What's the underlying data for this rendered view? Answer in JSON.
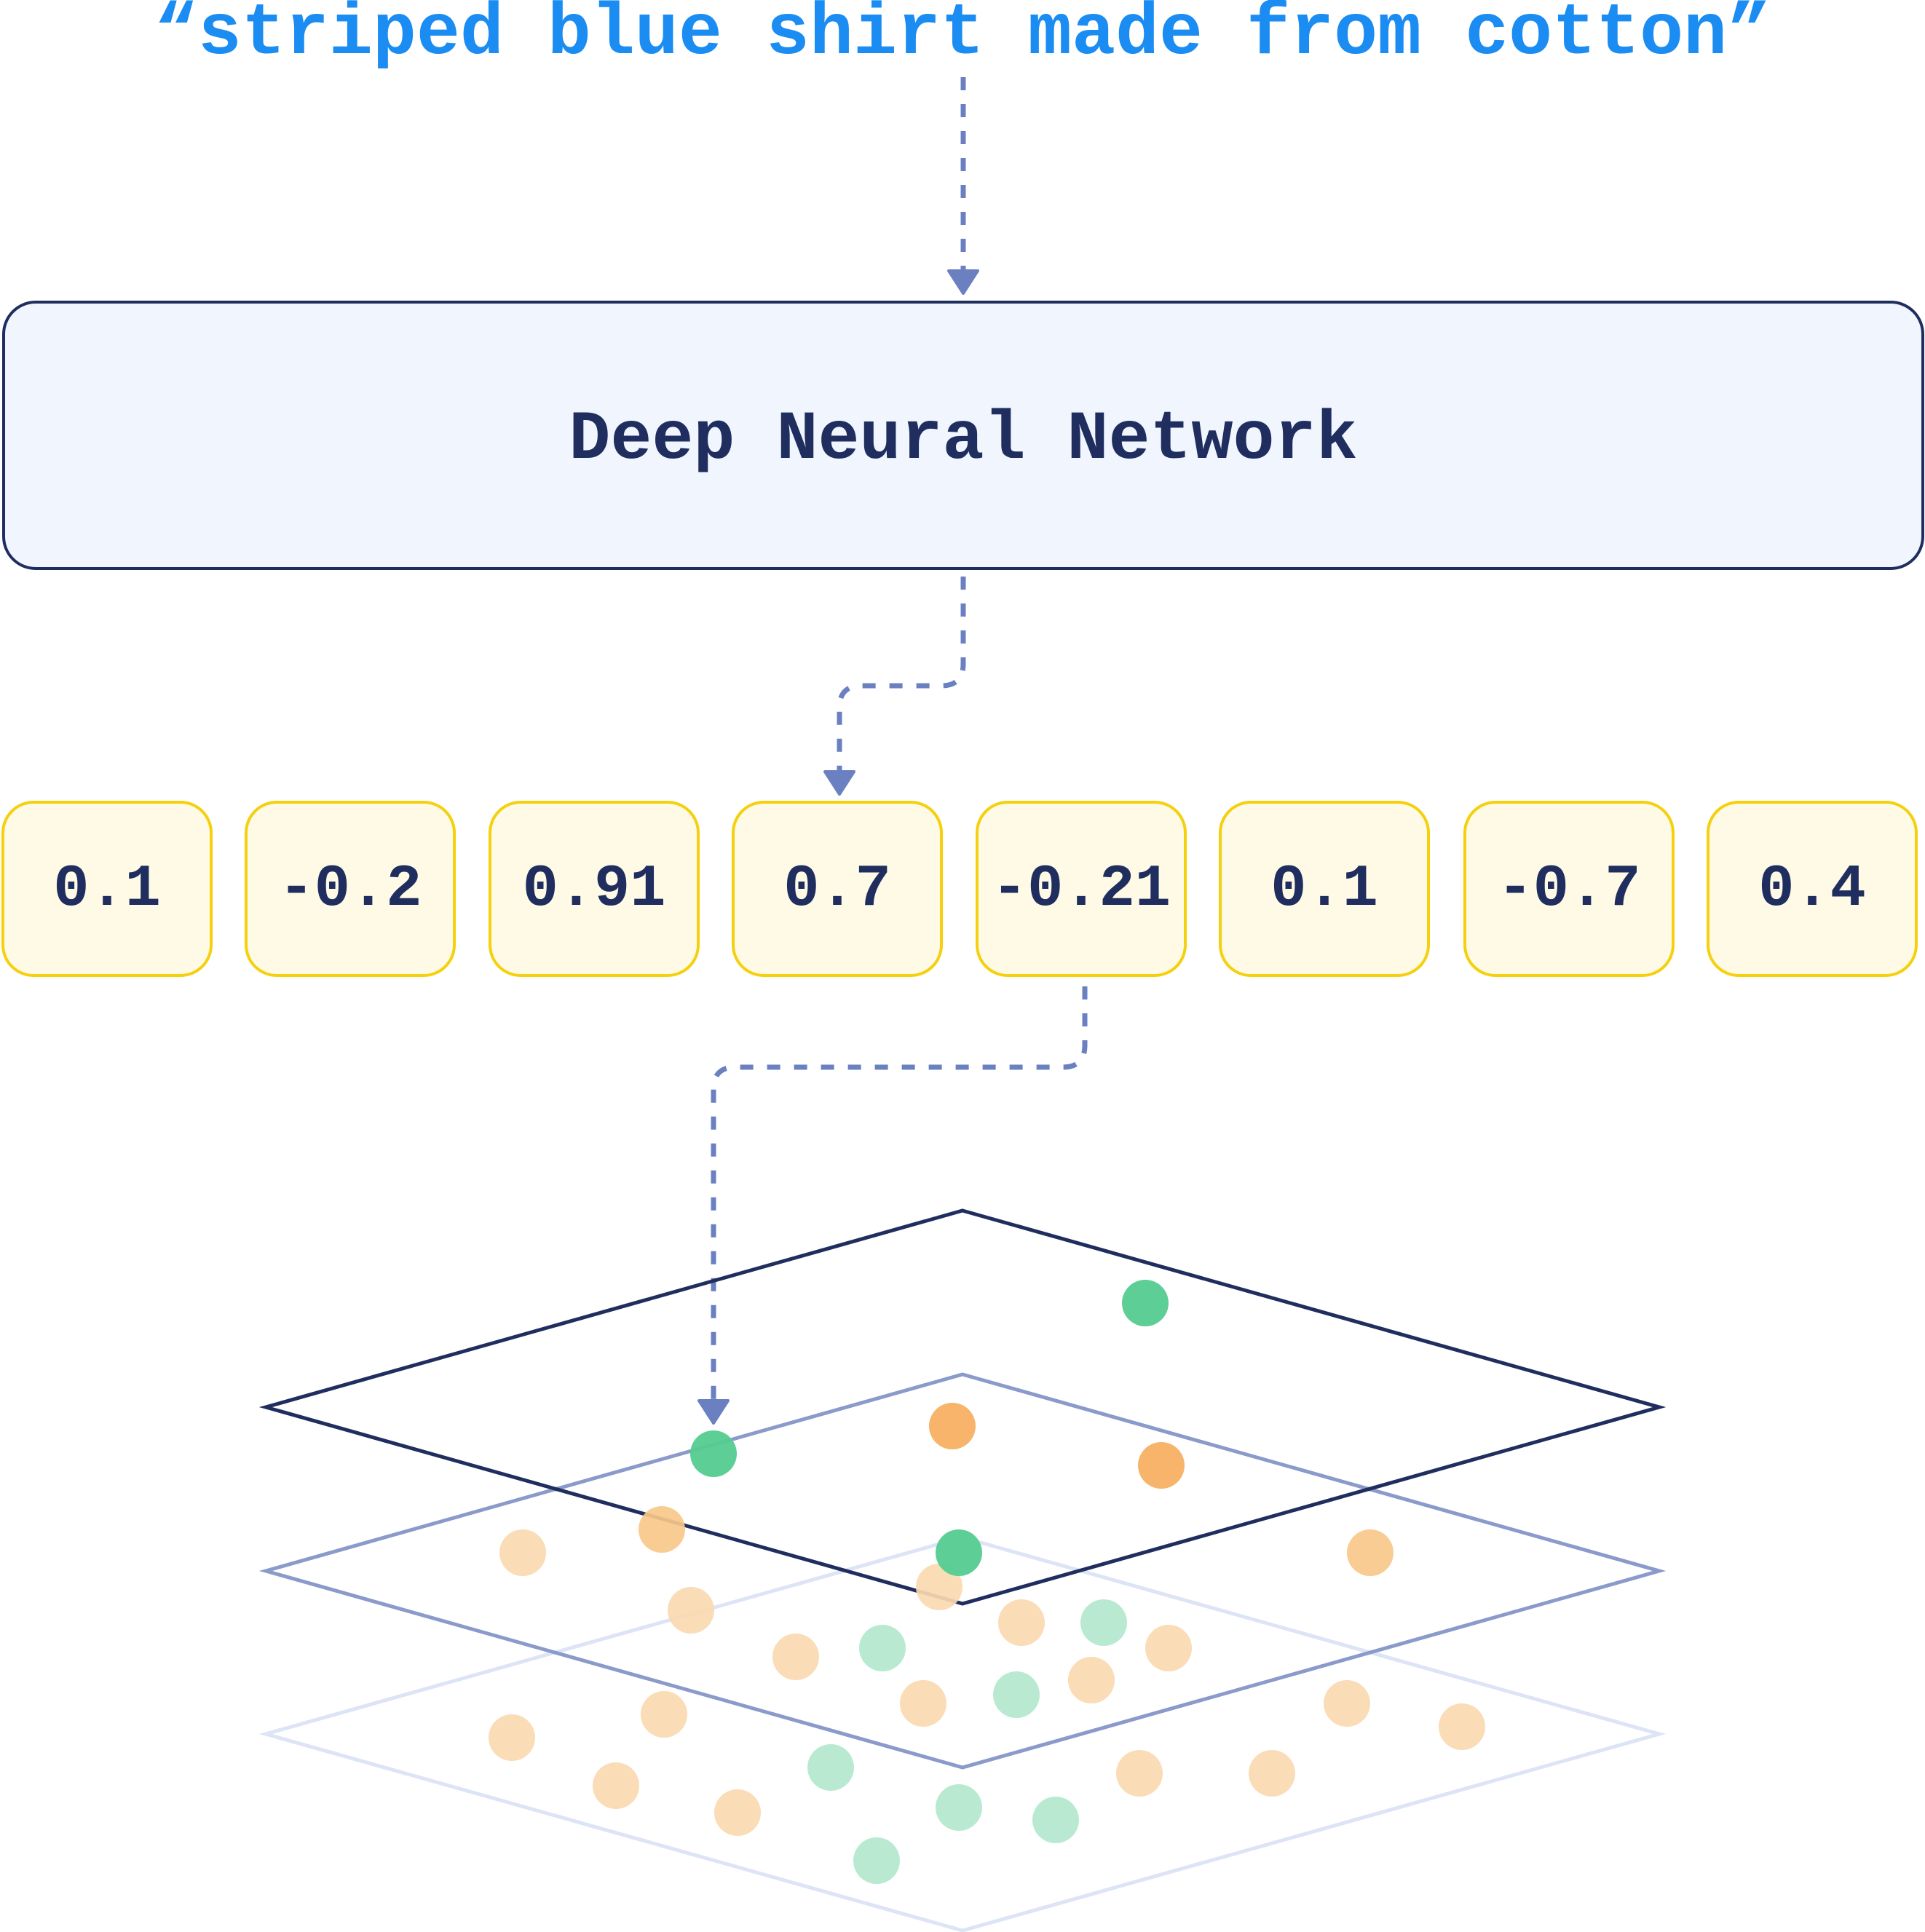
{
  "query": {
    "text": "“striped blue shirt made from cotton”",
    "color": "#1A8CF2"
  },
  "model": {
    "label": "Deep Neural Network",
    "fill": "#F0F5FE",
    "border": "#1F2E5E"
  },
  "embedding": {
    "values": [
      "0.1",
      "-0.2",
      "0.91",
      "0.7",
      "-0.21",
      "0.1",
      "-0.7",
      "0.4"
    ],
    "fill": "#FFFAE6",
    "border": "#F5D00E"
  },
  "arrows": {
    "color": "#6A80C0",
    "connections": [
      {
        "from": "query",
        "to": "model"
      },
      {
        "from": "model",
        "to": "embedding-cell-4"
      },
      {
        "from": "embedding-cell-5",
        "to": "vector-space-point"
      }
    ]
  },
  "vector_space": {
    "layers": [
      {
        "name": "top",
        "stroke": "#1F2E5E"
      },
      {
        "name": "middle",
        "stroke": "#8A9BCB"
      },
      {
        "name": "bottom",
        "stroke": "#DCE4F6"
      }
    ],
    "colors": {
      "green": "#54CC90",
      "orange": "#F7B062",
      "orange_mid": "#F9C88A",
      "orange_faded": "#FAD9B1",
      "green_faded": "#B3E8CD"
    },
    "points": [
      {
        "layer": "top",
        "kind": "green",
        "shade": "green"
      },
      {
        "layer": "top",
        "kind": "green",
        "shade": "green",
        "target": true
      },
      {
        "layer": "top",
        "kind": "orange",
        "shade": "orange"
      },
      {
        "layer": "top",
        "kind": "orange",
        "shade": "orange"
      },
      {
        "layer": "top",
        "kind": "green",
        "shade": "green"
      },
      {
        "layer": "top",
        "kind": "orange",
        "shade": "orange_mid"
      },
      {
        "layer": "middle",
        "kind": "orange",
        "shade": "orange_mid"
      },
      {
        "layer": "middle",
        "kind": "orange",
        "shade": "orange_faded"
      },
      {
        "layer": "middle",
        "kind": "orange",
        "shade": "orange_faded"
      },
      {
        "layer": "middle",
        "kind": "orange",
        "shade": "orange_faded"
      },
      {
        "layer": "middle",
        "kind": "orange",
        "shade": "orange_faded"
      },
      {
        "layer": "middle",
        "kind": "green",
        "shade": "green_faded"
      },
      {
        "layer": "middle",
        "kind": "orange",
        "shade": "orange_faded"
      },
      {
        "layer": "middle",
        "kind": "green",
        "shade": "green_faded"
      },
      {
        "layer": "middle",
        "kind": "orange",
        "shade": "orange_faded"
      },
      {
        "layer": "middle",
        "kind": "orange",
        "shade": "orange_faded"
      },
      {
        "layer": "middle",
        "kind": "green",
        "shade": "green_faded"
      },
      {
        "layer": "middle",
        "kind": "orange",
        "shade": "orange_faded"
      },
      {
        "layer": "bottom",
        "kind": "orange",
        "shade": "orange_faded"
      },
      {
        "layer": "bottom",
        "kind": "orange",
        "shade": "orange_faded"
      },
      {
        "layer": "bottom",
        "kind": "orange",
        "shade": "orange_faded"
      },
      {
        "layer": "bottom",
        "kind": "orange",
        "shade": "orange_faded"
      },
      {
        "layer": "bottom",
        "kind": "green",
        "shade": "green_faded"
      },
      {
        "layer": "bottom",
        "kind": "green",
        "shade": "green_faded"
      },
      {
        "layer": "bottom",
        "kind": "green",
        "shade": "green_faded"
      },
      {
        "layer": "bottom",
        "kind": "green",
        "shade": "green_faded"
      },
      {
        "layer": "bottom",
        "kind": "orange",
        "shade": "orange_faded"
      },
      {
        "layer": "bottom",
        "kind": "orange",
        "shade": "orange_faded"
      },
      {
        "layer": "bottom",
        "kind": "orange",
        "shade": "orange_faded"
      },
      {
        "layer": "bottom",
        "kind": "orange",
        "shade": "orange_faded"
      }
    ]
  }
}
